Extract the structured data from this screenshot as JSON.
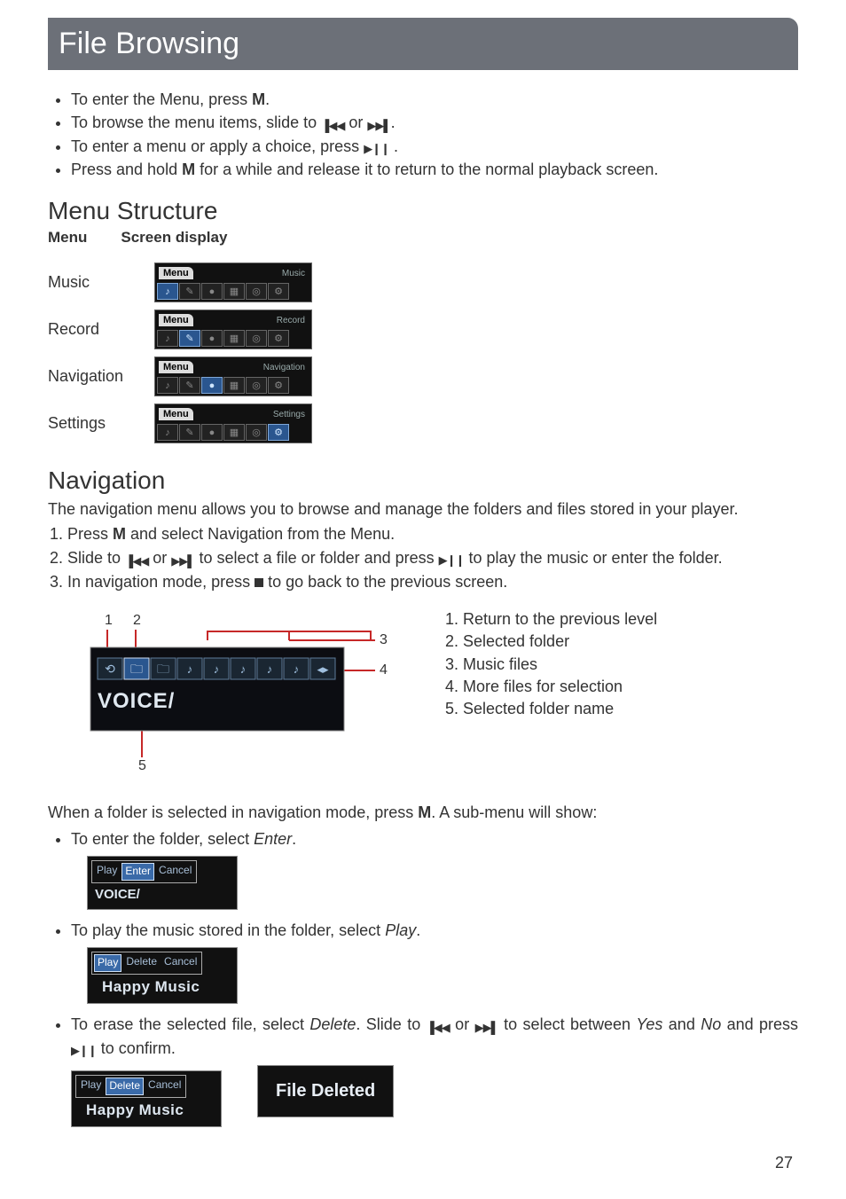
{
  "title": "File Browsing",
  "intro_bullets": [
    {
      "pre": "To enter the Menu, press ",
      "bold": "M",
      "post": "."
    },
    {
      "pre": "To browse the menu items, slide to ",
      "icon1": "prev",
      "mid": "or ",
      "icon2": "next",
      "post": "."
    },
    {
      "pre": "To enter a menu or apply a choice, press ",
      "icon1": "playpause",
      "post": "."
    },
    {
      "pre": "Press and hold ",
      "bold": "M",
      "post": " for a while and release it to return to the normal playback screen."
    }
  ],
  "menu_structure": {
    "heading": "Menu Structure",
    "col1": "Menu",
    "col2": "Screen display",
    "rows": [
      {
        "label": "Music",
        "tab": "Menu",
        "right": "Music",
        "active": 0
      },
      {
        "label": "Record",
        "tab": "Menu",
        "right": "Record",
        "active": 1
      },
      {
        "label": "Navigation",
        "tab": "Menu",
        "right": "Navigation",
        "active": 2
      },
      {
        "label": "Settings",
        "tab": "Menu",
        "right": "Settings",
        "active": 5
      }
    ],
    "icon_glyphs": [
      "♪",
      "✎",
      "●",
      "▦",
      "◎",
      "⚙"
    ]
  },
  "navigation": {
    "heading": "Navigation",
    "intro": "The navigation menu allows you to browse and manage the folders and files stored in your player.",
    "steps": [
      {
        "parts": [
          {
            "t": "Press "
          },
          {
            "b": "M"
          },
          {
            "t": " and select Navigation from the Menu."
          }
        ]
      },
      {
        "parts": [
          {
            "t": "Slide to "
          },
          {
            "icon": "prev"
          },
          {
            "t": "or "
          },
          {
            "icon": "next"
          },
          {
            "t": " to select a file or folder and press "
          },
          {
            "icon": "playpause"
          },
          {
            "t": " to play the music or enter the folder."
          }
        ]
      },
      {
        "parts": [
          {
            "t": "In navigation mode, press "
          },
          {
            "icon": "stop"
          },
          {
            "t": " to go back to the previous screen."
          }
        ]
      }
    ],
    "diagram": {
      "callouts": {
        "1": "1",
        "2": "2",
        "3": "3",
        "4": "4",
        "5": "5"
      },
      "folder_name": "VOICE/"
    },
    "legend": [
      "Return to the previous level",
      "Selected folder",
      "Music files",
      "More files for selection",
      "Selected folder name"
    ]
  },
  "submenu": {
    "intro_pre": "When a folder is selected in navigation mode, press ",
    "intro_bold": "M",
    "intro_post": ". A sub-menu will show:",
    "items": [
      {
        "pre": "To enter the folder, select ",
        "em": "Enter",
        "post": ".",
        "screen": {
          "buttons": [
            "Play",
            "Enter",
            "Cancel"
          ],
          "selected": 1,
          "label": "VOICE/"
        }
      },
      {
        "pre": "To play the music stored in the folder, select ",
        "em": "Play",
        "post": ".",
        "screen": {
          "buttons": [
            "Play",
            "Delete",
            "Cancel"
          ],
          "selected": 0,
          "label": "Happy Music"
        }
      },
      {
        "pre": "To erase the selected file, select ",
        "em": "Delete",
        "mid1": ". Slide to ",
        "icon1": "prev",
        "mid2": "or ",
        "icon2": "next",
        "mid3": " to select between ",
        "em2": "Yes",
        "mid4": " and ",
        "em3": "No",
        "post": " and press ",
        "icon3": "playpause",
        "post2": " to confirm.",
        "screen": {
          "buttons": [
            "Play",
            "Delete",
            "Cancel"
          ],
          "selected": 1,
          "label": "Happy Music"
        },
        "deleted": "File Deleted"
      }
    ]
  },
  "page_number": "27"
}
